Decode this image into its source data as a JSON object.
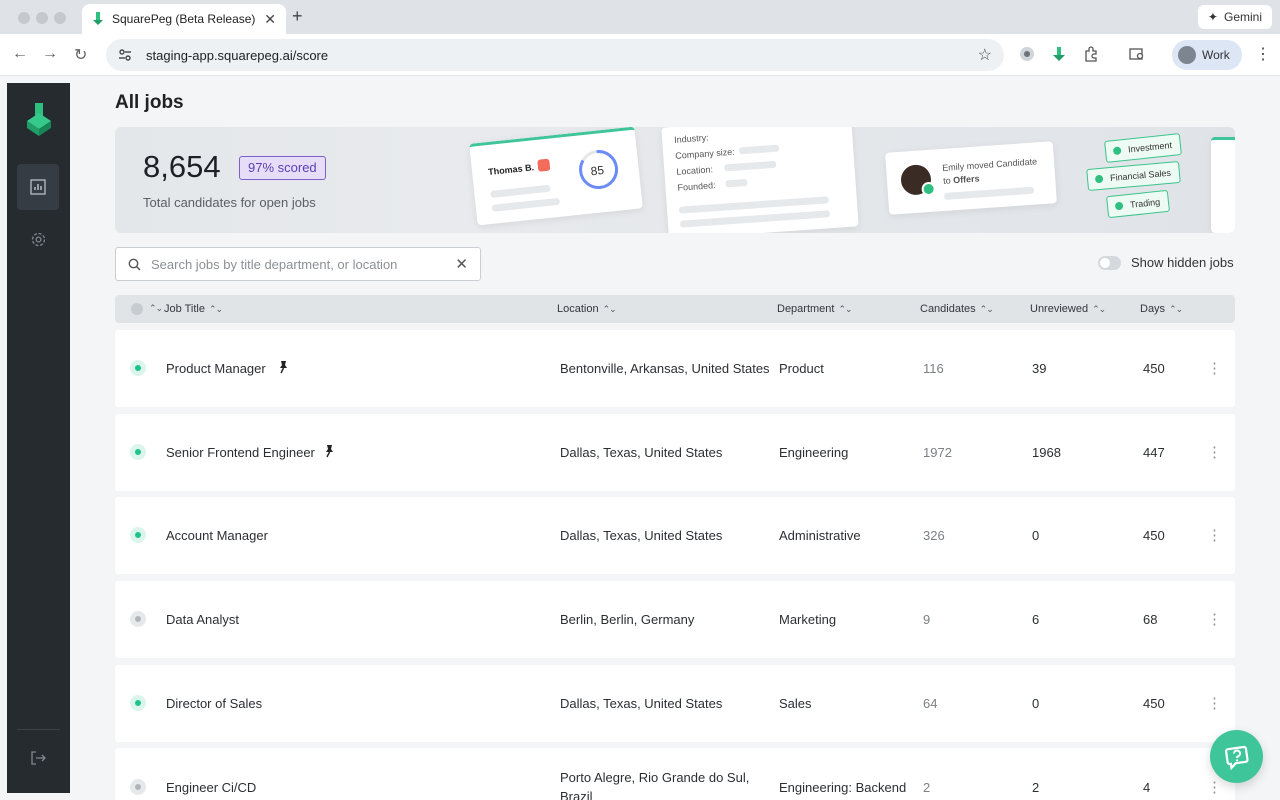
{
  "browser": {
    "tab_title": "SquarePeg (Beta Release)",
    "url": "staging-app.squarepeg.ai/score",
    "gemini_label": "Gemini",
    "profile_label": "Work"
  },
  "page": {
    "title": "All jobs"
  },
  "banner": {
    "total": "8,654",
    "scored_badge": "97% scored",
    "subtitle": "Total candidates for open jobs",
    "deco": {
      "candidate_name": "Thomas B.",
      "score": "85",
      "field_industry": "Industry:",
      "field_company_size": "Company size:",
      "field_location": "Location:",
      "field_founded": "Founded:",
      "activity_line1": "Emily moved Candidate",
      "activity_line2_prefix": "to ",
      "activity_line2_bold": "Offers",
      "tags": [
        "Investment",
        "Financial Sales",
        "Trading"
      ]
    }
  },
  "search": {
    "placeholder": "Search jobs by title department, or location"
  },
  "toggle": {
    "label": "Show hidden jobs",
    "on": false
  },
  "table": {
    "headers": {
      "job_title": "Job Title",
      "location": "Location",
      "department": "Department",
      "candidates": "Candidates",
      "unreviewed": "Unreviewed",
      "days": "Days"
    },
    "rows": [
      {
        "status": "active",
        "title": "Product Manager",
        "pinned": true,
        "location": "Bentonville, Arkansas, United States",
        "department": "Product",
        "candidates": "116",
        "unreviewed": "39",
        "days": "450"
      },
      {
        "status": "active",
        "title": "Senior Frontend Engineer",
        "pinned": true,
        "location": "Dallas, Texas, United States",
        "department": "Engineering",
        "candidates": "1972",
        "unreviewed": "1968",
        "days": "447"
      },
      {
        "status": "active",
        "title": "Account Manager",
        "pinned": false,
        "location": "Dallas, Texas, United States",
        "department": "Administrative",
        "candidates": "326",
        "unreviewed": "0",
        "days": "450"
      },
      {
        "status": "inactive",
        "title": "Data Analyst",
        "pinned": false,
        "location": "Berlin, Berlin, Germany",
        "department": "Marketing",
        "candidates": "9",
        "unreviewed": "6",
        "days": "68"
      },
      {
        "status": "active",
        "title": "Director of Sales",
        "pinned": false,
        "location": "Dallas, Texas, United States",
        "department": "Sales",
        "candidates": "64",
        "unreviewed": "0",
        "days": "450"
      },
      {
        "status": "inactive",
        "title": "Engineer Ci/CD",
        "pinned": false,
        "location_line1": "Porto Alegre, Rio Grande do Sul,",
        "location_line2": "Brazil",
        "department": "Engineering: Backend",
        "candidates": "2",
        "unreviewed": "2",
        "days": "4"
      }
    ]
  },
  "colors": {
    "accent_green": "#1fc28b",
    "sidebar_bg": "#262b30",
    "badge_purple": "#7b61c9"
  },
  "icons": {
    "sidebar": [
      "squarepeg-logo-icon",
      "chart-icon",
      "gear-icon",
      "logout-icon"
    ],
    "help": "help-chat-icon"
  }
}
